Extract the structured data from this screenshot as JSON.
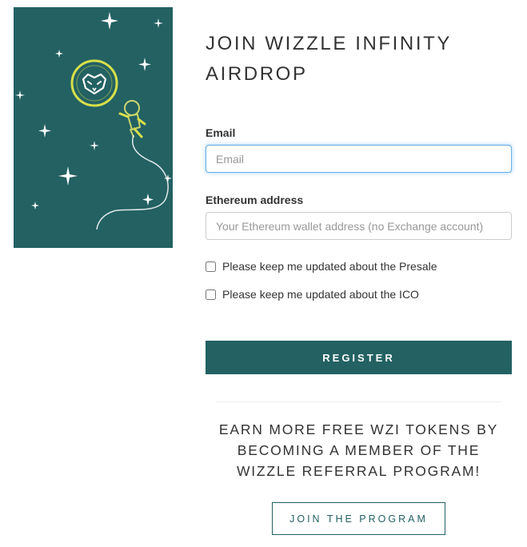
{
  "page": {
    "title": "JOIN WIZZLE INFINITY AIRDROP"
  },
  "form": {
    "email_label": "Email",
    "email_placeholder": "Email",
    "email_value": "",
    "eth_label": "Ethereum address",
    "eth_placeholder": "Your Ethereum wallet address (no Exchange account)",
    "eth_value": "",
    "checkbox_presale": {
      "label": "Please keep me updated about the Presale",
      "checked": false
    },
    "checkbox_ico": {
      "label": "Please keep me updated about the ICO",
      "checked": false
    },
    "register_label": "REGISTER"
  },
  "referral": {
    "text": "EARN MORE FREE WZI TOKENS BY BECOMING A MEMBER OF THE WIZZLE REFERRAL PROGRAM!",
    "join_label": "JOIN THE PROGRAM"
  },
  "colors": {
    "brand": "#236163",
    "logo_ring": "#d7e04a",
    "focus_border": "#66afe9"
  },
  "icons": {
    "logo": "panda-logo-icon",
    "astronaut": "astronaut-icon",
    "stars": "star-icon"
  }
}
